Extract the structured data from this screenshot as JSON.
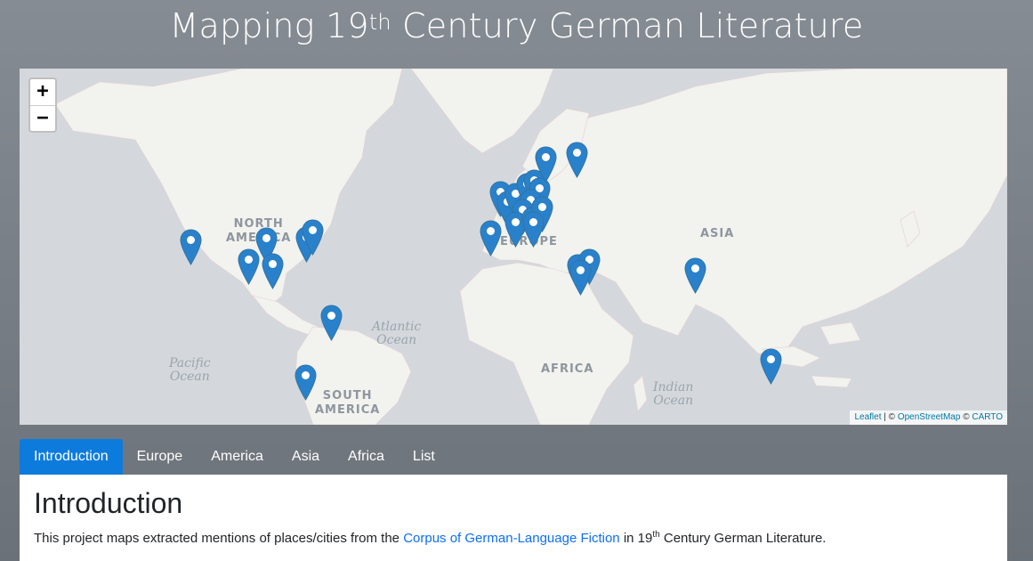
{
  "header": {
    "title_pre": "Mapping 19",
    "title_sup": "th",
    "title_post": " Century German Literature"
  },
  "map": {
    "zoom_in_label": "+",
    "zoom_out_label": "−",
    "labels": {
      "north_america_1": "NORTH",
      "north_america_2": "AMERICA",
      "south_america_1": "SOUTH",
      "south_america_2": "AMERICA",
      "europe": "EUROPE",
      "asia": "ASIA",
      "africa": "AFRICA",
      "atlantic_1": "Atlantic",
      "atlantic_2": "Ocean",
      "pacific_1": "Pacific",
      "pacific_2": "Ocean",
      "indian_1": "Indian",
      "indian_2": "Ocean"
    },
    "attribution": {
      "leaflet": "Leaflet",
      "sep1": " | © ",
      "osm": "OpenStreetMap",
      "sep2": " © ",
      "carto": "CARTO"
    },
    "marker_color": "#2a81cb",
    "marker_icon": "map-pin-icon"
  },
  "tabs": [
    {
      "label": "Introduction",
      "active": true
    },
    {
      "label": "Europe"
    },
    {
      "label": "America"
    },
    {
      "label": "Asia"
    },
    {
      "label": "Africa"
    },
    {
      "label": "List"
    }
  ],
  "content": {
    "heading": "Introduction",
    "text_pre": "This project maps extracted mentions of places/cities from the ",
    "link_text": "Corpus of German-Language Fiction",
    "text_mid": " in 19",
    "text_sup": "th",
    "text_post": " Century German Literature."
  }
}
